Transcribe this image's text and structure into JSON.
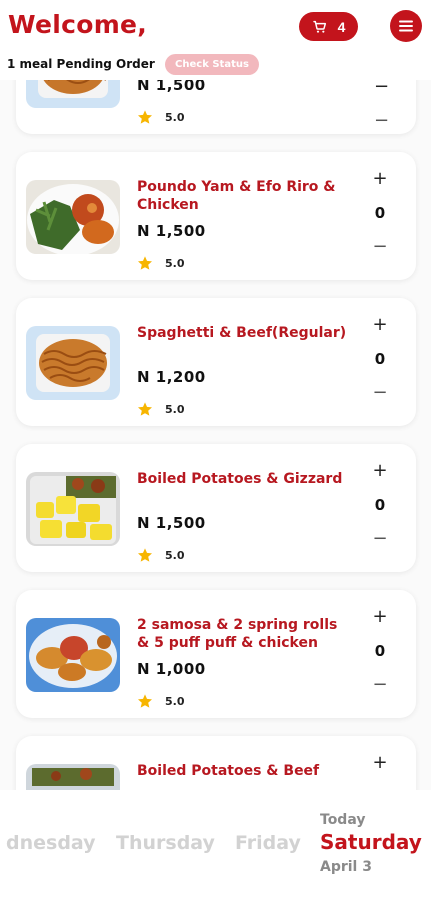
{
  "header": {
    "title": "Welcome,",
    "cart_count": "4",
    "pending_text": "1 meal Pending Order",
    "check_status_label": "Check Status"
  },
  "colors": {
    "brand_red": "#c3141c",
    "check_status_bg": "#f2b8bd",
    "star": "#f7b500"
  },
  "meals": [
    {
      "name": "",
      "price": "N 1,500",
      "rating": "5.0",
      "quantity": "",
      "image": "spaghetti-plate"
    },
    {
      "name": "Poundo Yam & Efo Riro & Chicken",
      "price": "N 1,500",
      "rating": "5.0",
      "quantity": "0",
      "image": "efo-riro-chicken"
    },
    {
      "name": "Spaghetti & Beef(Regular)",
      "price": "N 1,200",
      "rating": "5.0",
      "quantity": "0",
      "image": "spaghetti-plate"
    },
    {
      "name": "Boiled Potatoes & Gizzard",
      "price": "N 1,500",
      "rating": "5.0",
      "quantity": "0",
      "image": "boiled-potatoes"
    },
    {
      "name": "2 samosa & 2 spring rolls & 5 puff puff & chicken",
      "price": "N 1,000",
      "rating": "5.0",
      "quantity": "0",
      "image": "snack-platter"
    },
    {
      "name": "Boiled Potatoes & Beef",
      "price": "",
      "rating": "",
      "quantity": "",
      "image": "boiled-potatoes"
    }
  ],
  "days": {
    "prev2": "dnesday",
    "prev1": "Thursday",
    "prev0": "Friday",
    "today_label": "Today",
    "active": "Saturday",
    "active_date": "April 3"
  }
}
